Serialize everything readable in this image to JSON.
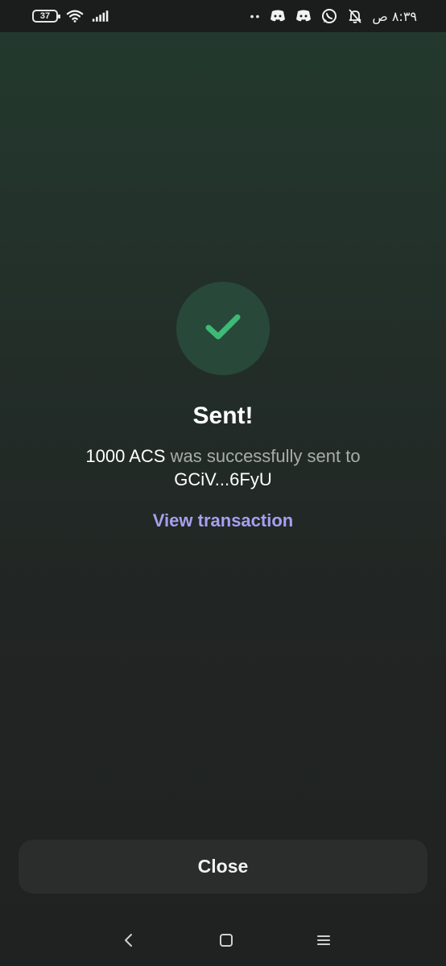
{
  "status_bar": {
    "battery_level": "37",
    "time": "٨:٣٩ ص",
    "dots": "••",
    "icons": [
      "wifi-icon",
      "signal-icon",
      "discord-icon",
      "discord-icon",
      "whatsapp-icon",
      "bell-muted-icon"
    ]
  },
  "success": {
    "icon": "checkmark-icon",
    "title": "Sent!",
    "amount": "1000 ACS",
    "message_middle": " was successfully sent to",
    "recipient": "GCiV...6FyU",
    "link_label": "View transaction"
  },
  "actions": {
    "close_label": "Close"
  },
  "nav_bar": {
    "icons": [
      "back-icon",
      "home-icon",
      "menu-icon"
    ]
  },
  "colors": {
    "accent_green": "#3dba75",
    "link_purple": "#a79ff0",
    "circle_bg": "#28483a"
  }
}
